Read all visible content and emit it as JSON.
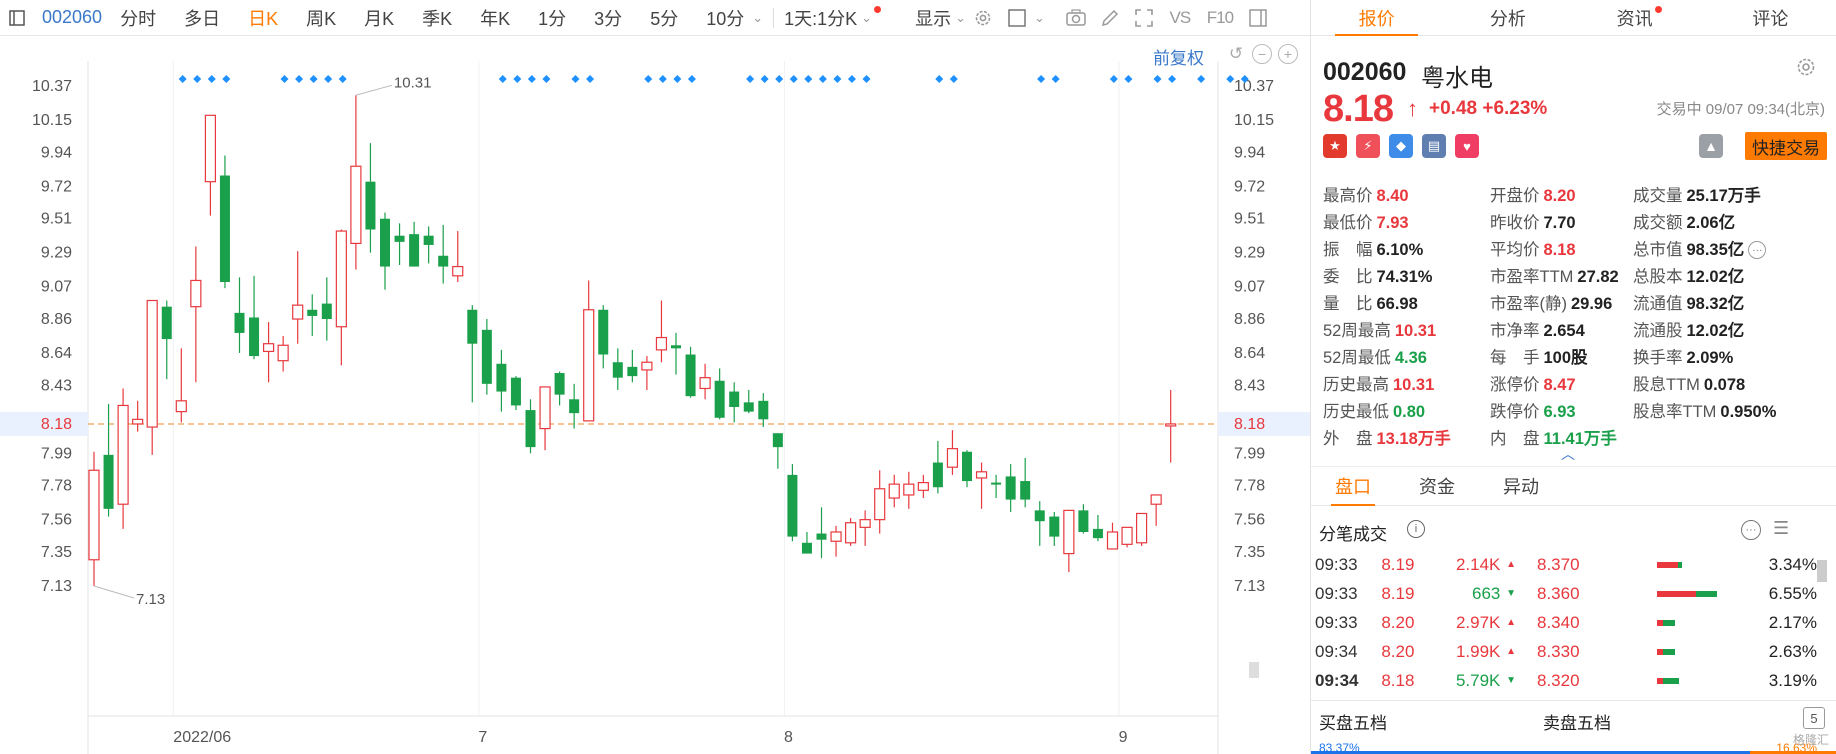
{
  "toolbar": {
    "code": "002060",
    "periods": [
      "分时",
      "多日",
      "日K",
      "周K",
      "月K",
      "季K",
      "年K",
      "1分",
      "3分",
      "5分",
      "10分"
    ],
    "active_period": "日K",
    "range": "1天:1分K",
    "display": "显示"
  },
  "chart_links": {
    "adjust": "前复权"
  },
  "chart_data": {
    "type": "candlestick",
    "y_ticks": [
      10.37,
      10.15,
      9.94,
      9.72,
      9.51,
      9.29,
      9.07,
      8.86,
      8.64,
      8.43,
      8.18,
      7.99,
      7.78,
      7.56,
      7.35,
      7.13
    ],
    "ylim": [
      7.0,
      10.5
    ],
    "x_labels": [
      {
        "label": "2022/06",
        "index": 6
      },
      {
        "label": "7",
        "index": 27
      },
      {
        "label": "8",
        "index": 48
      },
      {
        "label": "9",
        "index": 71
      }
    ],
    "current_price": 8.18,
    "max_annotation": {
      "label": "10.31",
      "index": 18
    },
    "min_annotation": {
      "label": "7.13",
      "index": 0
    },
    "event_marker_indices": [
      3,
      4,
      5,
      6,
      10,
      11,
      12,
      13,
      14,
      25,
      26,
      27,
      28,
      30,
      31,
      35,
      36,
      37,
      38,
      42,
      43,
      44,
      45,
      46,
      47,
      48,
      49,
      50,
      55,
      56,
      62,
      63,
      67,
      68,
      70,
      71,
      73,
      75,
      76
    ],
    "candles": [
      {
        "o": 7.3,
        "h": 8.0,
        "l": 7.13,
        "c": 7.88
      },
      {
        "o": 7.98,
        "h": 8.31,
        "l": 7.58,
        "c": 7.63
      },
      {
        "o": 7.66,
        "h": 8.41,
        "l": 7.5,
        "c": 8.3
      },
      {
        "o": 8.18,
        "h": 8.33,
        "l": 8.13,
        "c": 8.21
      },
      {
        "o": 8.16,
        "h": 8.6,
        "l": 7.98,
        "c": 8.98
      },
      {
        "o": 8.94,
        "h": 8.98,
        "l": 8.47,
        "c": 8.73
      },
      {
        "o": 8.26,
        "h": 8.67,
        "l": 8.19,
        "c": 8.33
      },
      {
        "o": 8.94,
        "h": 9.33,
        "l": 8.45,
        "c": 9.11
      },
      {
        "o": 9.75,
        "h": 10.18,
        "l": 9.53,
        "c": 10.18
      },
      {
        "o": 9.79,
        "h": 9.92,
        "l": 9.06,
        "c": 9.1
      },
      {
        "o": 8.9,
        "h": 9.13,
        "l": 8.64,
        "c": 8.77
      },
      {
        "o": 8.87,
        "h": 9.14,
        "l": 8.6,
        "c": 8.62
      },
      {
        "o": 8.65,
        "h": 8.84,
        "l": 8.45,
        "c": 8.7
      },
      {
        "o": 8.59,
        "h": 8.75,
        "l": 8.52,
        "c": 8.69
      },
      {
        "o": 8.86,
        "h": 9.3,
        "l": 8.7,
        "c": 8.95
      },
      {
        "o": 8.92,
        "h": 9.02,
        "l": 8.75,
        "c": 8.88
      },
      {
        "o": 8.96,
        "h": 9.13,
        "l": 8.72,
        "c": 8.86
      },
      {
        "o": 8.81,
        "h": 9.44,
        "l": 8.56,
        "c": 9.43
      },
      {
        "o": 9.35,
        "h": 10.31,
        "l": 9.18,
        "c": 9.85
      },
      {
        "o": 9.75,
        "h": 10.0,
        "l": 9.29,
        "c": 9.44
      },
      {
        "o": 9.51,
        "h": 9.55,
        "l": 9.05,
        "c": 9.2
      },
      {
        "o": 9.4,
        "h": 9.48,
        "l": 9.21,
        "c": 9.36
      },
      {
        "o": 9.41,
        "h": 9.49,
        "l": 9.23,
        "c": 9.2
      },
      {
        "o": 9.4,
        "h": 9.46,
        "l": 9.22,
        "c": 9.34
      },
      {
        "o": 9.27,
        "h": 9.47,
        "l": 9.09,
        "c": 9.2
      },
      {
        "o": 9.14,
        "h": 9.43,
        "l": 9.1,
        "c": 9.2
      },
      {
        "o": 8.92,
        "h": 8.95,
        "l": 8.32,
        "c": 8.7
      },
      {
        "o": 8.79,
        "h": 8.86,
        "l": 8.37,
        "c": 8.44
      },
      {
        "o": 8.57,
        "h": 8.66,
        "l": 8.26,
        "c": 8.39
      },
      {
        "o": 8.48,
        "h": 8.49,
        "l": 8.27,
        "c": 8.3
      },
      {
        "o": 8.27,
        "h": 8.34,
        "l": 7.99,
        "c": 8.03
      },
      {
        "o": 8.15,
        "h": 8.35,
        "l": 8.01,
        "c": 8.42
      },
      {
        "o": 8.51,
        "h": 8.52,
        "l": 8.3,
        "c": 8.37
      },
      {
        "o": 8.34,
        "h": 8.44,
        "l": 8.15,
        "c": 8.25
      },
      {
        "o": 8.2,
        "h": 9.11,
        "l": 8.2,
        "c": 8.92
      },
      {
        "o": 8.92,
        "h": 8.95,
        "l": 8.54,
        "c": 8.63
      },
      {
        "o": 8.58,
        "h": 8.67,
        "l": 8.4,
        "c": 8.48
      },
      {
        "o": 8.55,
        "h": 8.66,
        "l": 8.45,
        "c": 8.49
      },
      {
        "o": 8.53,
        "h": 8.62,
        "l": 8.4,
        "c": 8.58
      },
      {
        "o": 8.66,
        "h": 8.98,
        "l": 8.58,
        "c": 8.74
      },
      {
        "o": 8.69,
        "h": 8.77,
        "l": 8.5,
        "c": 8.67
      },
      {
        "o": 8.63,
        "h": 8.68,
        "l": 8.35,
        "c": 8.36
      },
      {
        "o": 8.41,
        "h": 8.57,
        "l": 8.34,
        "c": 8.48
      },
      {
        "o": 8.46,
        "h": 8.54,
        "l": 8.21,
        "c": 8.22
      },
      {
        "o": 8.39,
        "h": 8.45,
        "l": 8.19,
        "c": 8.29
      },
      {
        "o": 8.32,
        "h": 8.4,
        "l": 8.25,
        "c": 8.26
      },
      {
        "o": 8.33,
        "h": 8.38,
        "l": 8.16,
        "c": 8.21
      },
      {
        "o": 8.12,
        "h": 8.11,
        "l": 7.89,
        "c": 8.03
      },
      {
        "o": 7.85,
        "h": 7.92,
        "l": 7.42,
        "c": 7.45
      },
      {
        "o": 7.41,
        "h": 7.48,
        "l": 7.34,
        "c": 7.34
      },
      {
        "o": 7.47,
        "h": 7.64,
        "l": 7.31,
        "c": 7.43
      },
      {
        "o": 7.42,
        "h": 7.52,
        "l": 7.32,
        "c": 7.48
      },
      {
        "o": 7.41,
        "h": 7.57,
        "l": 7.39,
        "c": 7.54
      },
      {
        "o": 7.51,
        "h": 7.62,
        "l": 7.39,
        "c": 7.56
      },
      {
        "o": 7.56,
        "h": 7.88,
        "l": 7.47,
        "c": 7.76
      },
      {
        "o": 7.7,
        "h": 7.85,
        "l": 7.64,
        "c": 7.79
      },
      {
        "o": 7.72,
        "h": 7.87,
        "l": 7.63,
        "c": 7.79
      },
      {
        "o": 7.75,
        "h": 7.85,
        "l": 7.7,
        "c": 7.8
      },
      {
        "o": 7.93,
        "h": 8.07,
        "l": 7.73,
        "c": 7.77
      },
      {
        "o": 7.9,
        "h": 8.14,
        "l": 7.85,
        "c": 8.02
      },
      {
        "o": 8.0,
        "h": 8.01,
        "l": 7.77,
        "c": 7.81
      },
      {
        "o": 7.83,
        "h": 7.93,
        "l": 7.63,
        "c": 7.87
      },
      {
        "o": 7.8,
        "h": 7.85,
        "l": 7.7,
        "c": 7.79
      },
      {
        "o": 7.84,
        "h": 7.92,
        "l": 7.61,
        "c": 7.69
      },
      {
        "o": 7.81,
        "h": 7.96,
        "l": 7.64,
        "c": 7.69
      },
      {
        "o": 7.62,
        "h": 7.68,
        "l": 7.39,
        "c": 7.55
      },
      {
        "o": 7.58,
        "h": 7.61,
        "l": 7.39,
        "c": 7.45
      },
      {
        "o": 7.34,
        "h": 7.61,
        "l": 7.22,
        "c": 7.62
      },
      {
        "o": 7.62,
        "h": 7.66,
        "l": 7.47,
        "c": 7.48
      },
      {
        "o": 7.5,
        "h": 7.59,
        "l": 7.42,
        "c": 7.44
      },
      {
        "o": 7.37,
        "h": 7.54,
        "l": 7.37,
        "c": 7.48
      },
      {
        "o": 7.4,
        "h": 7.51,
        "l": 7.38,
        "c": 7.51
      },
      {
        "o": 7.41,
        "h": 7.6,
        "l": 7.39,
        "c": 7.6
      },
      {
        "o": 7.66,
        "h": 7.71,
        "l": 7.52,
        "c": 7.72
      },
      {
        "o": 8.17,
        "h": 8.4,
        "l": 7.93,
        "c": 8.18
      }
    ]
  },
  "right_tabs": [
    "报价",
    "分析",
    "资讯",
    "评论"
  ],
  "stock": {
    "code": "002060",
    "name": "粤水电",
    "price": "8.18",
    "change": "+0.48",
    "change_pct": "+6.23%",
    "status": "交易中 09/07 09:34(北京)",
    "quick_trade": "快捷交易"
  },
  "stats": [
    [
      {
        "label": "最高价",
        "value": "8.40",
        "c": "up"
      },
      {
        "label": "开盘价",
        "value": "8.20",
        "c": "up"
      },
      {
        "label": "成交量",
        "value": "25.17万手",
        "c": "nv"
      }
    ],
    [
      {
        "label": "最低价",
        "value": "7.93",
        "c": "up"
      },
      {
        "label": "昨收价",
        "value": "7.70",
        "c": "nv"
      },
      {
        "label": "成交额",
        "value": "2.06亿",
        "c": "nv"
      }
    ],
    [
      {
        "label": "振　幅",
        "value": "6.10%",
        "c": "nv"
      },
      {
        "label": "平均价",
        "value": "8.18",
        "c": "up"
      },
      {
        "label": "总市值",
        "value": "98.35亿",
        "c": "nv"
      }
    ],
    [
      {
        "label": "委　比",
        "value": "74.31%",
        "c": "nv"
      },
      {
        "label": "市盈率TTM",
        "value": "27.82",
        "c": "nv"
      },
      {
        "label": "总股本",
        "value": "12.02亿",
        "c": "nv"
      }
    ],
    [
      {
        "label": "量　比",
        "value": "66.98",
        "c": "nv"
      },
      {
        "label": "市盈率(静)",
        "value": "29.96",
        "c": "nv"
      },
      {
        "label": "流通值",
        "value": "98.32亿",
        "c": "nv"
      }
    ],
    [
      {
        "label": "52周最高",
        "value": "10.31",
        "c": "up"
      },
      {
        "label": "市净率",
        "value": "2.654",
        "c": "nv"
      },
      {
        "label": "流通股",
        "value": "12.02亿",
        "c": "nv"
      }
    ],
    [
      {
        "label": "52周最低",
        "value": "4.36",
        "c": "dn"
      },
      {
        "label": "每　手",
        "value": "100股",
        "c": "nv"
      },
      {
        "label": "换手率",
        "value": "2.09%",
        "c": "nv"
      }
    ],
    [
      {
        "label": "历史最高",
        "value": "10.31",
        "c": "up"
      },
      {
        "label": "涨停价",
        "value": "8.47",
        "c": "up"
      },
      {
        "label": "股息TTM",
        "value": "0.078",
        "c": "nv"
      }
    ],
    [
      {
        "label": "历史最低",
        "value": "0.80",
        "c": "dn"
      },
      {
        "label": "跌停价",
        "value": "6.93",
        "c": "dn"
      },
      {
        "label": "股息率TTM",
        "value": "0.950%",
        "c": "nv"
      }
    ],
    [
      {
        "label": "外　盘",
        "value": "13.18万手",
        "c": "up"
      },
      {
        "label": "内　盘",
        "value": "11.41万手",
        "c": "dn"
      },
      {
        "label": "",
        "value": "",
        "c": "nv"
      }
    ]
  ],
  "panel_tabs": [
    "盘口",
    "资金",
    "异动"
  ],
  "ticks": {
    "title": "分笔成交",
    "rows": [
      {
        "time": "09:33",
        "price": "8.19",
        "vol": "2.14K",
        "dir": "up"
      },
      {
        "time": "09:33",
        "price": "8.19",
        "vol": "663",
        "dir": "dn"
      },
      {
        "time": "09:33",
        "price": "8.20",
        "vol": "2.97K",
        "dir": "up"
      },
      {
        "time": "09:34",
        "price": "8.20",
        "vol": "1.99K",
        "dir": "up"
      },
      {
        "time": "09:34",
        "price": "8.18",
        "vol": "5.79K",
        "dir": "dn"
      }
    ]
  },
  "depth": [
    {
      "price": "8.370",
      "pct": "3.34%",
      "r": 0.3,
      "g": 0.05
    },
    {
      "price": "8.360",
      "pct": "6.55%",
      "r": 0.55,
      "g": 0.3
    },
    {
      "price": "8.340",
      "pct": "2.17%",
      "r": 0.08,
      "g": 0.18
    },
    {
      "price": "8.330",
      "pct": "2.63%",
      "r": 0.08,
      "g": 0.18
    },
    {
      "price": "8.320",
      "pct": "3.19%",
      "r": 0.08,
      "g": 0.24
    }
  ],
  "book": {
    "buy": "买盘五档",
    "sell": "卖盘五档",
    "levels": "5",
    "buy_ratio": "83.37%",
    "sell_ratio": "16.63%"
  },
  "watermark": "格隆汇"
}
